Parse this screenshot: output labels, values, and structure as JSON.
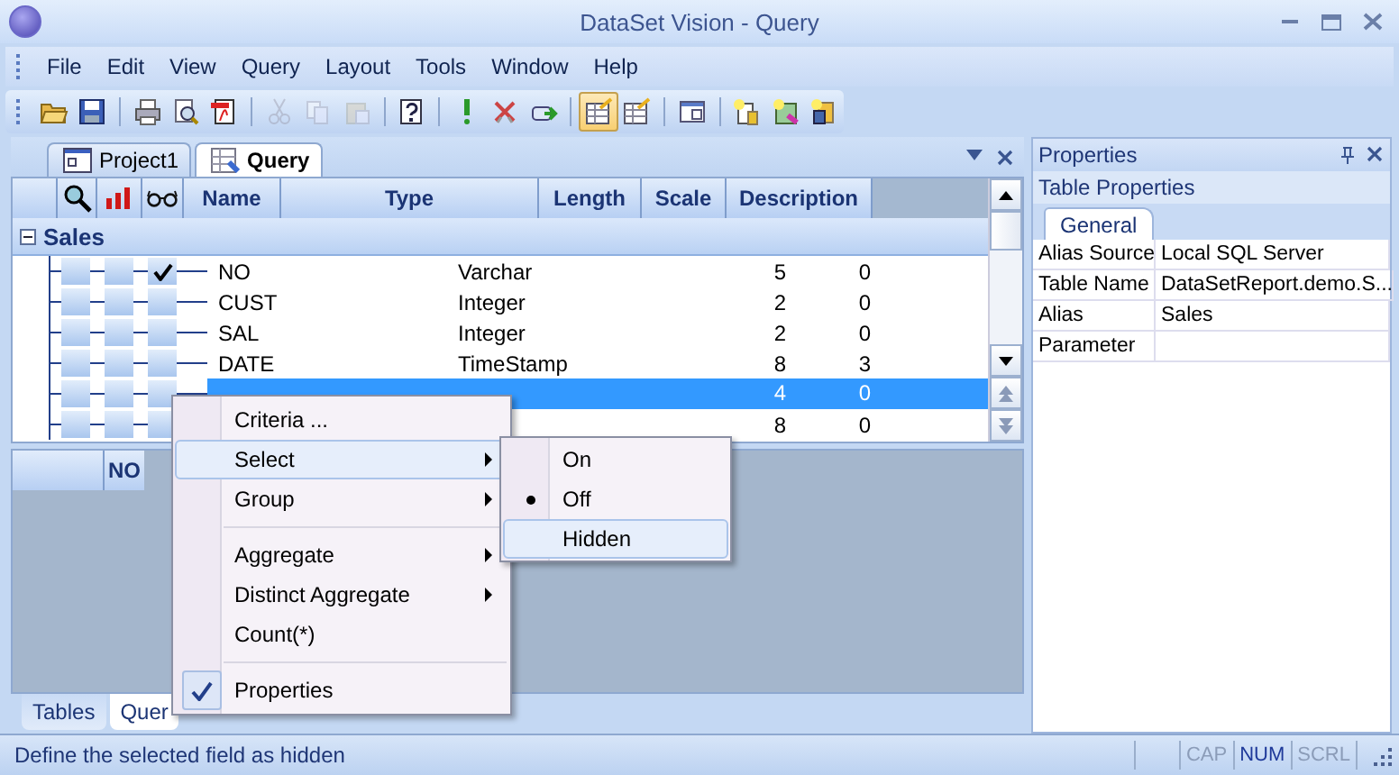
{
  "window": {
    "title": "DataSet Vision - Query"
  },
  "menu": [
    "File",
    "Edit",
    "View",
    "Query",
    "Layout",
    "Tools",
    "Window",
    "Help"
  ],
  "toolbar": [
    [
      {
        "disabled": false,
        "pressed": false
      },
      {
        "disabled": false,
        "pressed": false
      }
    ],
    [
      {
        "disabled": false,
        "pressed": false
      },
      {
        "disabled": false,
        "pressed": false
      },
      {
        "disabled": false,
        "pressed": false
      }
    ],
    [
      {
        "disabled": true,
        "pressed": false
      },
      {
        "disabled": true,
        "pressed": false
      },
      {
        "disabled": true,
        "pressed": false
      }
    ],
    [
      {
        "disabled": false,
        "pressed": false
      }
    ],
    [
      {
        "disabled": false,
        "pressed": false
      },
      {
        "disabled": false,
        "pressed": false
      },
      {
        "disabled": false,
        "pressed": false
      }
    ],
    [
      {
        "disabled": false,
        "pressed": true
      },
      {
        "disabled": false,
        "pressed": false
      }
    ],
    [
      {
        "disabled": false,
        "pressed": false
      }
    ],
    [
      {
        "disabled": false,
        "pressed": false
      },
      {
        "disabled": false,
        "pressed": false
      },
      {
        "disabled": false,
        "pressed": false
      }
    ]
  ],
  "doc_tabs": [
    {
      "label": "Project1",
      "selected": false
    },
    {
      "label": "Query",
      "selected": true
    }
  ],
  "grid": {
    "columns": [
      "Name",
      "Type",
      "Length",
      "Scale",
      "Description"
    ],
    "group": {
      "label": "Sales",
      "expanded": true
    },
    "rows": [
      {
        "name": "NO",
        "type": "Varchar",
        "length": "5",
        "scale": "0",
        "checked": true,
        "selected": false
      },
      {
        "name": "CUST",
        "type": "Integer",
        "length": "2",
        "scale": "0",
        "checked": false,
        "selected": false
      },
      {
        "name": "SAL",
        "type": "Integer",
        "length": "2",
        "scale": "0",
        "checked": false,
        "selected": false
      },
      {
        "name": "DATE",
        "type": "TimeStamp",
        "length": "8",
        "scale": "3",
        "checked": false,
        "selected": false
      },
      {
        "length": "4",
        "scale": "0",
        "checked": false,
        "selected": true
      },
      {
        "length": "8",
        "scale": "0",
        "checked": false,
        "selected": false
      }
    ]
  },
  "result": {
    "columns": [
      "NO"
    ]
  },
  "bottom_tabs": [
    {
      "label": "Tables",
      "selected": false
    },
    {
      "label": "Quer",
      "selected": true
    }
  ],
  "context_menu": [
    {
      "kind": "item",
      "label": "Criteria ...",
      "submenu": false,
      "highlighted": false,
      "checked": false
    },
    {
      "kind": "item",
      "label": "Select",
      "submenu": true,
      "highlighted": true,
      "checked": false
    },
    {
      "kind": "item",
      "label": "Group",
      "submenu": true,
      "highlighted": false,
      "checked": false
    },
    {
      "kind": "separator"
    },
    {
      "kind": "item",
      "label": "Aggregate",
      "submenu": true,
      "highlighted": false,
      "checked": false
    },
    {
      "kind": "item",
      "label": "Distinct Aggregate",
      "submenu": true,
      "highlighted": false,
      "checked": false
    },
    {
      "kind": "item",
      "label": "Count(*)",
      "submenu": false,
      "highlighted": false,
      "checked": false
    },
    {
      "kind": "separator"
    },
    {
      "kind": "item",
      "label": "Properties",
      "submenu": false,
      "highlighted": false,
      "checked": true
    }
  ],
  "submenu": [
    {
      "label": "On",
      "selected": false,
      "highlighted": false
    },
    {
      "label": "Off",
      "selected": true,
      "highlighted": false
    },
    {
      "label": "Hidden",
      "selected": false,
      "highlighted": true
    }
  ],
  "properties": {
    "title": "Properties",
    "subtitle": "Table Properties",
    "tabs": [
      {
        "label": "General",
        "selected": true
      }
    ],
    "rows": [
      {
        "key": "Alias Source",
        "value": "Local SQL Server"
      },
      {
        "key": "Table Name",
        "value": "DataSetReport.demo.S..."
      },
      {
        "key": "Alias",
        "value": "Sales"
      },
      {
        "key": "Parameter"
      }
    ]
  },
  "status_bar": {
    "text": "Define the selected field as hidden",
    "indicators": [
      {
        "label": "CAP",
        "on": false
      },
      {
        "label": "NUM",
        "on": true
      },
      {
        "label": "SCRL",
        "on": false
      }
    ]
  }
}
